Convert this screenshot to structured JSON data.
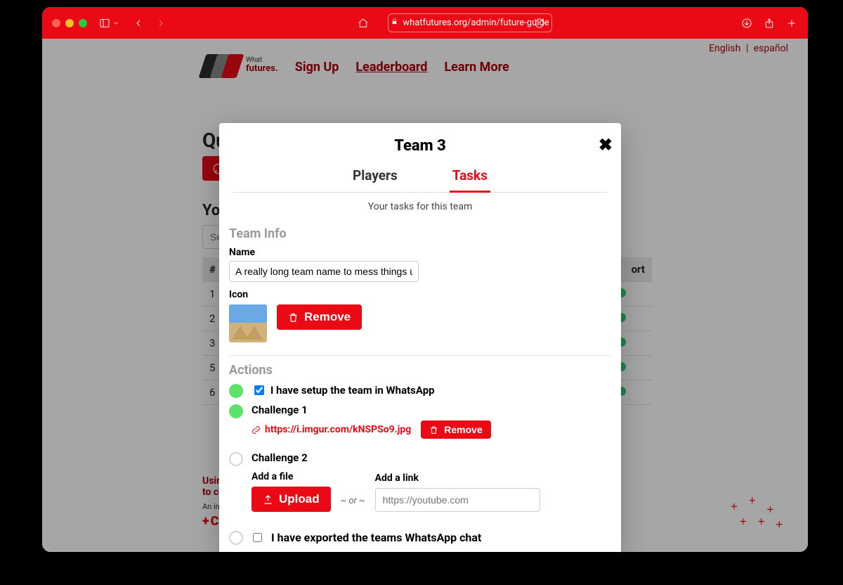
{
  "browser": {
    "url": "whatfutures.org/admin/future-guide",
    "lang_en": "English",
    "lang_es": "español"
  },
  "nav": {
    "logo_line1": "What",
    "logo_line2": "futures.",
    "signup": "Sign Up",
    "leaderboard": "Leaderboard",
    "learnmore": "Learn More"
  },
  "page": {
    "quick_heading": "Qui",
    "your_heading": "You",
    "search_placeholder": "Sear",
    "table_col_num": "#",
    "table_col_last": "ort",
    "rows": [
      "1",
      "2",
      "3",
      "5",
      "6"
    ],
    "footer_line1": "Using",
    "footer_line2": "to cha",
    "footer_sub": "An initiati"
  },
  "modal": {
    "title": "Team 3",
    "tab_players": "Players",
    "tab_tasks": "Tasks",
    "subtitle": "Your tasks for this team",
    "team_info_heading": "Team Info",
    "name_label": "Name",
    "name_value": "A really long team name to mess things up",
    "icon_label": "Icon",
    "remove_icon": "Remove",
    "actions_heading": "Actions",
    "a1_label": "I have setup the team in WhatsApp",
    "a2_title": "Challenge 1",
    "a2_url": "https://i.imgur.com/kNSPSo9.jpg",
    "a2_remove": "Remove",
    "a3_title": "Challenge 2",
    "a3_add_file_label": "Add a file",
    "a3_upload": "Upload",
    "a3_or": "~ or ~",
    "a3_add_link_label": "Add a link",
    "a3_link_placeholder": "https://youtube.com",
    "a4_label": "I have exported the teams WhatsApp chat"
  }
}
